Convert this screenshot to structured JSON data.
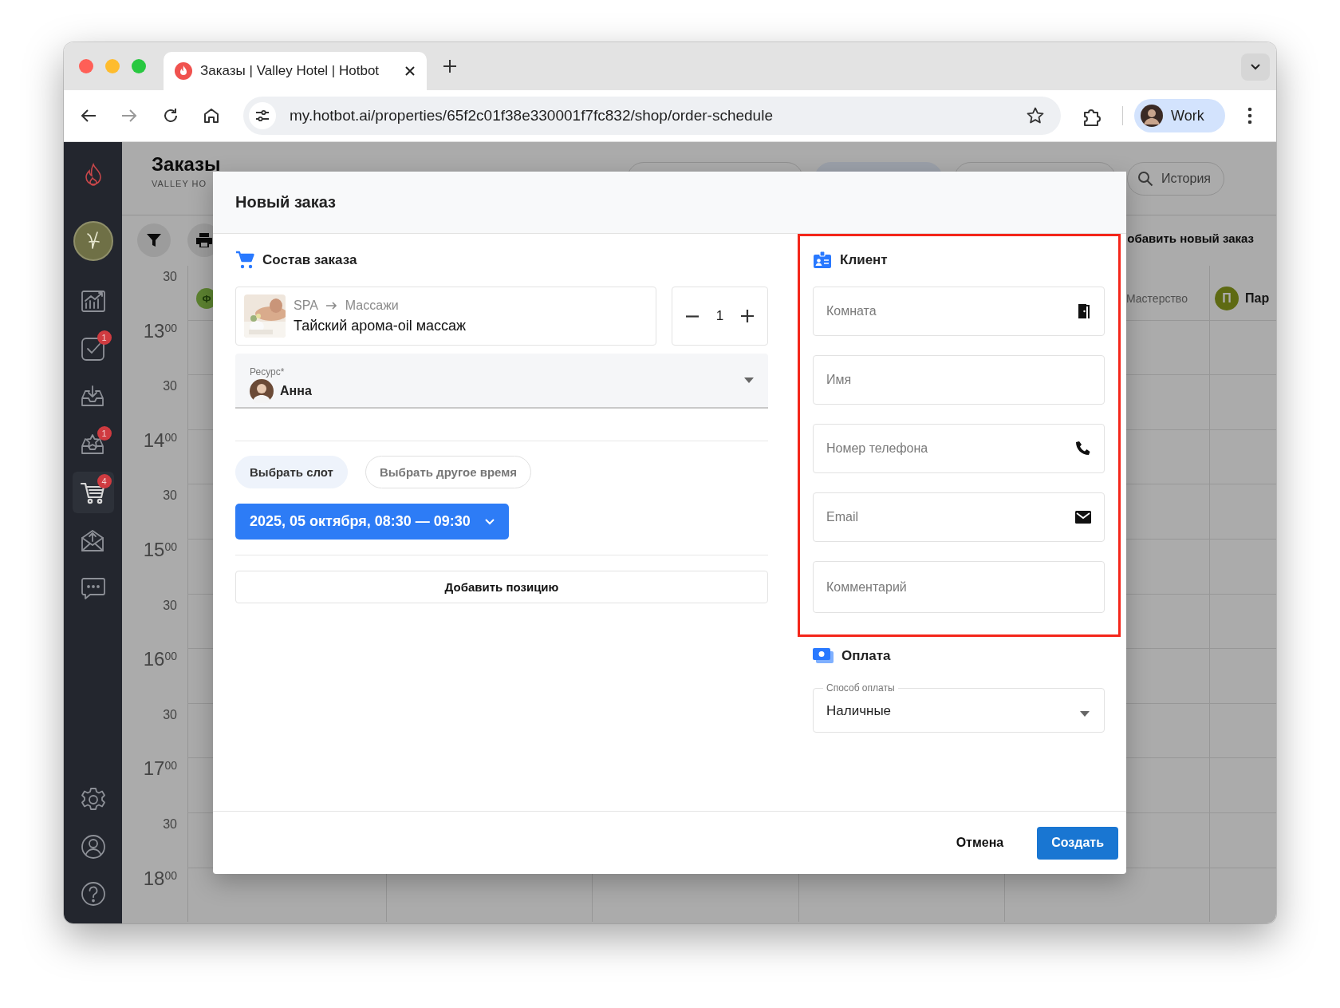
{
  "browser": {
    "tab_title": "Заказы | Valley Hotel | Hotbot",
    "url": "my.hotbot.ai/properties/65f2c01f38e330001f7fc832/shop/order-schedule",
    "profile": "Work"
  },
  "sidebar": {
    "items": [
      {
        "kind": "chart",
        "selected": false
      },
      {
        "kind": "tasks",
        "badge": "1",
        "selected": false
      },
      {
        "kind": "inbox",
        "selected": false
      },
      {
        "kind": "reviews",
        "badge": "1",
        "selected": false
      },
      {
        "kind": "cart",
        "badge": "4",
        "selected": true
      },
      {
        "kind": "mail",
        "selected": false
      },
      {
        "kind": "chat",
        "selected": false
      }
    ],
    "bottom_items": [
      {
        "kind": "settings"
      },
      {
        "kind": "profile"
      },
      {
        "kind": "help"
      }
    ]
  },
  "page": {
    "title": "Заказы",
    "subtitle": "VALLEY HO",
    "history_button": "История",
    "add_order_button": "обавить новый заказ"
  },
  "schedule": {
    "columns": [
      {
        "avatar": "Ф"
      },
      {
        "name": "Мастерство"
      },
      {
        "avatar": "П",
        "name": "Пар"
      }
    ],
    "times": [
      {
        "kind": "half",
        "label": "30"
      },
      {
        "kind": "hour",
        "label": "13$^{00}$"
      },
      {
        "kind": "half",
        "label": "30"
      },
      {
        "kind": "hour",
        "label": "14$^{00}$"
      },
      {
        "kind": "half",
        "label": "30"
      },
      {
        "kind": "hour",
        "label": "15$^{00}$"
      },
      {
        "kind": "half",
        "label": "30"
      },
      {
        "kind": "hour",
        "label": "16$^{00}$"
      },
      {
        "kind": "half",
        "label": "30"
      },
      {
        "kind": "hour",
        "label": "17$^{00}$"
      },
      {
        "kind": "half",
        "label": "30"
      },
      {
        "kind": "hour",
        "label": "18$^{00}$"
      }
    ]
  },
  "modal": {
    "title": "Новый заказ",
    "order": {
      "title": "Состав заказа",
      "item": {
        "category": "SPA",
        "subcategory": "Массажи",
        "name": "Тайский арома-oil массаж",
        "quantity": "1"
      },
      "resource": {
        "label": "Ресурс*",
        "value": "Анна"
      },
      "slot_modes": [
        {
          "label": "Выбрать слот",
          "selected": true
        },
        {
          "label": "Выбрать другое время",
          "selected": false
        }
      ],
      "date_button": "2025, 05 октября, 08:30 — 09:30",
      "add_item_button": "Добавить позицию"
    },
    "client": {
      "title": "Клиент",
      "highlighted": true,
      "fields": [
        {
          "kind": "room",
          "placeholder": "Комната"
        },
        {
          "kind": "text",
          "placeholder": "Имя"
        },
        {
          "kind": "phone",
          "placeholder": "Номер телефона"
        },
        {
          "kind": "email",
          "placeholder": "Email"
        },
        {
          "kind": "comment",
          "placeholder": "Комментарий"
        }
      ]
    },
    "payment": {
      "title": "Оплата",
      "method": {
        "label": "Способ оплаты",
        "value": "Наличные"
      }
    },
    "buttons": [
      {
        "kind": "text",
        "label": "Отмена"
      },
      {
        "kind": "primary",
        "label": "Создать"
      }
    ]
  }
}
